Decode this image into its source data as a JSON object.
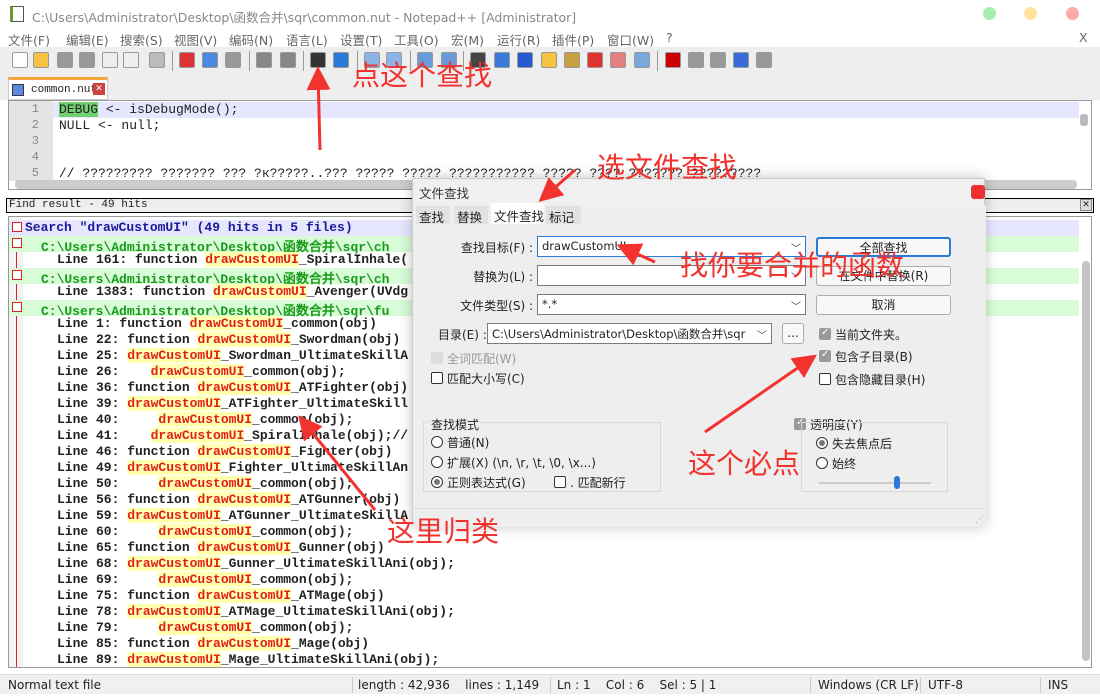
{
  "window": {
    "title": "C:\\Users\\Administrator\\Desktop\\函数合并\\sqr\\common.nut - Notepad++ [Administrator]",
    "close_x": "X",
    "controls": [
      "#a8eeb0",
      "#ffe39a",
      "#ffa8a8"
    ]
  },
  "menu": [
    "文件(F)",
    "编辑(E)",
    "搜索(S)",
    "视图(V)",
    "编码(N)",
    "语言(L)",
    "设置(T)",
    "工具(O)",
    "宏(M)",
    "运行(R)",
    "插件(P)",
    "窗口(W)",
    "?"
  ],
  "toolbar": [
    {
      "icon": "new-file-icon",
      "color": "#fff"
    },
    {
      "icon": "open-file-icon",
      "color": "#f5c242"
    },
    {
      "icon": "save-icon",
      "color": "#999"
    },
    {
      "icon": "save-all-icon",
      "color": "#999"
    },
    {
      "icon": "close-file-icon",
      "color": "#eee"
    },
    {
      "icon": "close-all-icon",
      "color": "#eee"
    },
    {
      "icon": "print-icon",
      "color": "#bbb"
    },
    {
      "icon": "cut-icon",
      "color": "#d33"
    },
    {
      "icon": "copy-icon",
      "color": "#4a8ae0"
    },
    {
      "icon": "paste-icon",
      "color": "#999"
    },
    {
      "icon": "undo-icon",
      "color": "#888"
    },
    {
      "icon": "redo-icon",
      "color": "#888"
    },
    {
      "icon": "find-binoculars-icon",
      "color": "#333"
    },
    {
      "icon": "replace-icon",
      "color": "#2a7ad8"
    },
    {
      "icon": "zoom-in-icon",
      "color": "#8ab4e8"
    },
    {
      "icon": "zoom-out-icon",
      "color": "#8ab4e8"
    },
    {
      "icon": "sync-vertical-icon",
      "color": "#6a9ad8"
    },
    {
      "icon": "sync-horizontal-icon",
      "color": "#6a9ad8"
    },
    {
      "icon": "word-wrap-icon",
      "color": "#444"
    },
    {
      "icon": "show-all-chars-icon",
      "color": "#3a7ad8"
    },
    {
      "icon": "indent-guide-icon",
      "color": "#2a5ad0"
    },
    {
      "icon": "user-language-icon",
      "color": "#f5c242"
    },
    {
      "icon": "document-map-icon",
      "color": "#c8a040"
    },
    {
      "icon": "function-list-icon",
      "color": "#d33"
    },
    {
      "icon": "folder-workspace-icon",
      "color": "#e08080"
    },
    {
      "icon": "monitoring-eye-icon",
      "color": "#7aa8d8"
    },
    {
      "icon": "record-macro-icon",
      "color": "#c00"
    },
    {
      "icon": "stop-record-icon",
      "color": "#999"
    },
    {
      "icon": "play-macro-icon",
      "color": "#999"
    },
    {
      "icon": "run-macro-multiple-icon",
      "color": "#3a6ad8"
    },
    {
      "icon": "save-macro-icon",
      "color": "#999"
    }
  ],
  "tab": {
    "label": "common.nut",
    "close": "✕"
  },
  "editor": {
    "lines": [
      {
        "n": "1",
        "code": "DEBUG <- isDebugMode();"
      },
      {
        "n": "2",
        "code": "NULL <- null;"
      },
      {
        "n": "3",
        "code": ""
      },
      {
        "n": "4",
        "code": ""
      },
      {
        "n": "5",
        "code": "// ????????? ??????? ??? ?к?????..??? ????? ????? ??????????? ????? ???? ??????? ?????????"
      }
    ]
  },
  "find_result": {
    "title": "Find result - 49 hits",
    "close": "✕",
    "rows": [
      {
        "type": "search",
        "text": "Search \"drawCustomUI\" (49 hits in 5 files)"
      },
      {
        "type": "path",
        "text": "C:\\Users\\Administrator\\Desktop\\函数合并\\sqr\\ch"
      },
      {
        "type": "hit",
        "pre": "Line 161: function ",
        "m": "drawCustomUI",
        "post": "_SpiralInhale("
      },
      {
        "type": "path",
        "text": "C:\\Users\\Administrator\\Desktop\\函数合并\\sqr\\ch"
      },
      {
        "type": "hit",
        "pre": "Line 1383: function ",
        "m": "drawCustomUI",
        "post": "_Avenger(UVdg"
      },
      {
        "type": "path",
        "text": "C:\\Users\\Administrator\\Desktop\\函数合并\\sqr\\fu"
      },
      {
        "type": "hit",
        "pre": "Line 1: function ",
        "m": "drawCustomUI",
        "post": "_common(obj)"
      },
      {
        "type": "hit",
        "pre": "Line 22: function ",
        "m": "drawCustomUI",
        "post": "_Swordman(obj)"
      },
      {
        "type": "hit",
        "pre": "Line 25: ",
        "m": "drawCustomUI",
        "post": "_Swordman_UltimateSkillA"
      },
      {
        "type": "hit",
        "pre": "Line 26:    ",
        "m": "drawCustomUI",
        "post": "_common(obj);"
      },
      {
        "type": "hit",
        "pre": "Line 36: function ",
        "m": "drawCustomUI",
        "post": "_ATFighter(obj)"
      },
      {
        "type": "hit",
        "pre": "Line 39: ",
        "m": "drawCustomUI",
        "post": "_ATFighter_UltimateSkill"
      },
      {
        "type": "hit",
        "pre": "Line 40:     ",
        "m": "drawCustomUI",
        "post": "_common(obj);"
      },
      {
        "type": "hit",
        "pre": "Line 41:    ",
        "m": "drawCustomUI",
        "post": "_SpiralInhale(obj);//"
      },
      {
        "type": "hit",
        "pre": "Line 46: function ",
        "m": "drawCustomUI",
        "post": "_Fighter(obj)"
      },
      {
        "type": "hit",
        "pre": "Line 49: ",
        "m": "drawCustomUI",
        "post": "_Fighter_UltimateSkillAn"
      },
      {
        "type": "hit",
        "pre": "Line 50:     ",
        "m": "drawCustomUI",
        "post": "_common(obj);"
      },
      {
        "type": "hit",
        "pre": "Line 56: function ",
        "m": "drawCustomUI",
        "post": "_ATGunner(obj)"
      },
      {
        "type": "hit",
        "pre": "Line 59: ",
        "m": "drawCustomUI",
        "post": "_ATGunner_UltimateSkillA"
      },
      {
        "type": "hit",
        "pre": "Line 60:     ",
        "m": "drawCustomUI",
        "post": "_common(obj);"
      },
      {
        "type": "hit",
        "pre": "Line 65: function ",
        "m": "drawCustomUI",
        "post": "_Gunner(obj)"
      },
      {
        "type": "hit",
        "pre": "Line 68: ",
        "m": "drawCustomUI",
        "post": "_Gunner_UltimateSkillAni(obj);"
      },
      {
        "type": "hit",
        "pre": "Line 69:     ",
        "m": "drawCustomUI",
        "post": "_common(obj);"
      },
      {
        "type": "hit",
        "pre": "Line 75: function ",
        "m": "drawCustomUI",
        "post": "_ATMage(obj)"
      },
      {
        "type": "hit",
        "pre": "Line 78: ",
        "m": "drawCustomUI",
        "post": "_ATMage_UltimateSkillAni(obj);"
      },
      {
        "type": "hit",
        "pre": "Line 79:     ",
        "m": "drawCustomUI",
        "post": "_common(obj);"
      },
      {
        "type": "hit",
        "pre": "Line 85: function ",
        "m": "drawCustomUI",
        "post": "_Mage(obj)"
      },
      {
        "type": "hit",
        "pre": "Line 89: ",
        "m": "drawCustomUI",
        "post": "_Mage_UltimateSkillAni(obj);"
      }
    ]
  },
  "dialog": {
    "title": "文件查找",
    "tabs": [
      "查找",
      "替换",
      "文件查找",
      "标记"
    ],
    "active_tab": 2,
    "find_label": "查找目标(F) :",
    "find_value": "drawCustomUI",
    "replace_label": "替换为(L) :",
    "replace_value": "",
    "filter_label": "文件类型(S) :",
    "filter_value": "*.*",
    "dir_label": "目录(E) :",
    "dir_value": "C:\\Users\\Administrator\\Desktop\\函数合并\\sqr",
    "browse": "...",
    "btn_find_all": "全部查找",
    "btn_replace_in_files": "在文件中替换(R)",
    "btn_cancel": "取消",
    "chk_current_folder": "当前文件夹。",
    "chk_subfolders": "包含子目录(B)",
    "chk_hidden": "包含隐藏目录(H)",
    "chk_whole_word": "全词匹配(W)",
    "chk_match_case": "匹配大小写(C)",
    "mode_title": "查找模式",
    "mode_normal": "普通(N)",
    "mode_extended": "扩展(X) (\\n, \\r, \\t, \\0, \\x...)",
    "mode_regex": "正则表达式(G)",
    "chk_dot_newline": ". 匹配新行",
    "transparency": "透明度(Y)",
    "trans_on_lose_focus": "失去焦点后",
    "trans_always": "始终",
    "transparency_level": 0.7,
    "checked": {
      "current_folder": true,
      "subfolders": true,
      "hidden": false,
      "whole_word": false,
      "match_case": false,
      "dot_newline": false,
      "transparency": true
    },
    "selected_mode": "regex",
    "selected_trans": "on_lose_focus"
  },
  "status": {
    "type": "Normal text file",
    "length": "length : 42,936    lines : 1,149",
    "pos": "Ln : 1    Col : 6    Sel : 5 | 1",
    "eol": "Windows (CR LF)",
    "enc": "UTF-8",
    "ins": "INS"
  },
  "annotations": [
    "点这个查找",
    "选文件查找",
    "找你要合并的函数",
    "这个必点",
    "这里归类"
  ],
  "colors": {
    "annotation": "#f2322e",
    "match_bg": "#ffffb0",
    "match_fg": "#e0201e",
    "path_bg": "#d8fcd8",
    "search_bg": "#e6e6ff",
    "path_fg": "#1a9a1a",
    "search_fg": "#1a1a9a"
  }
}
